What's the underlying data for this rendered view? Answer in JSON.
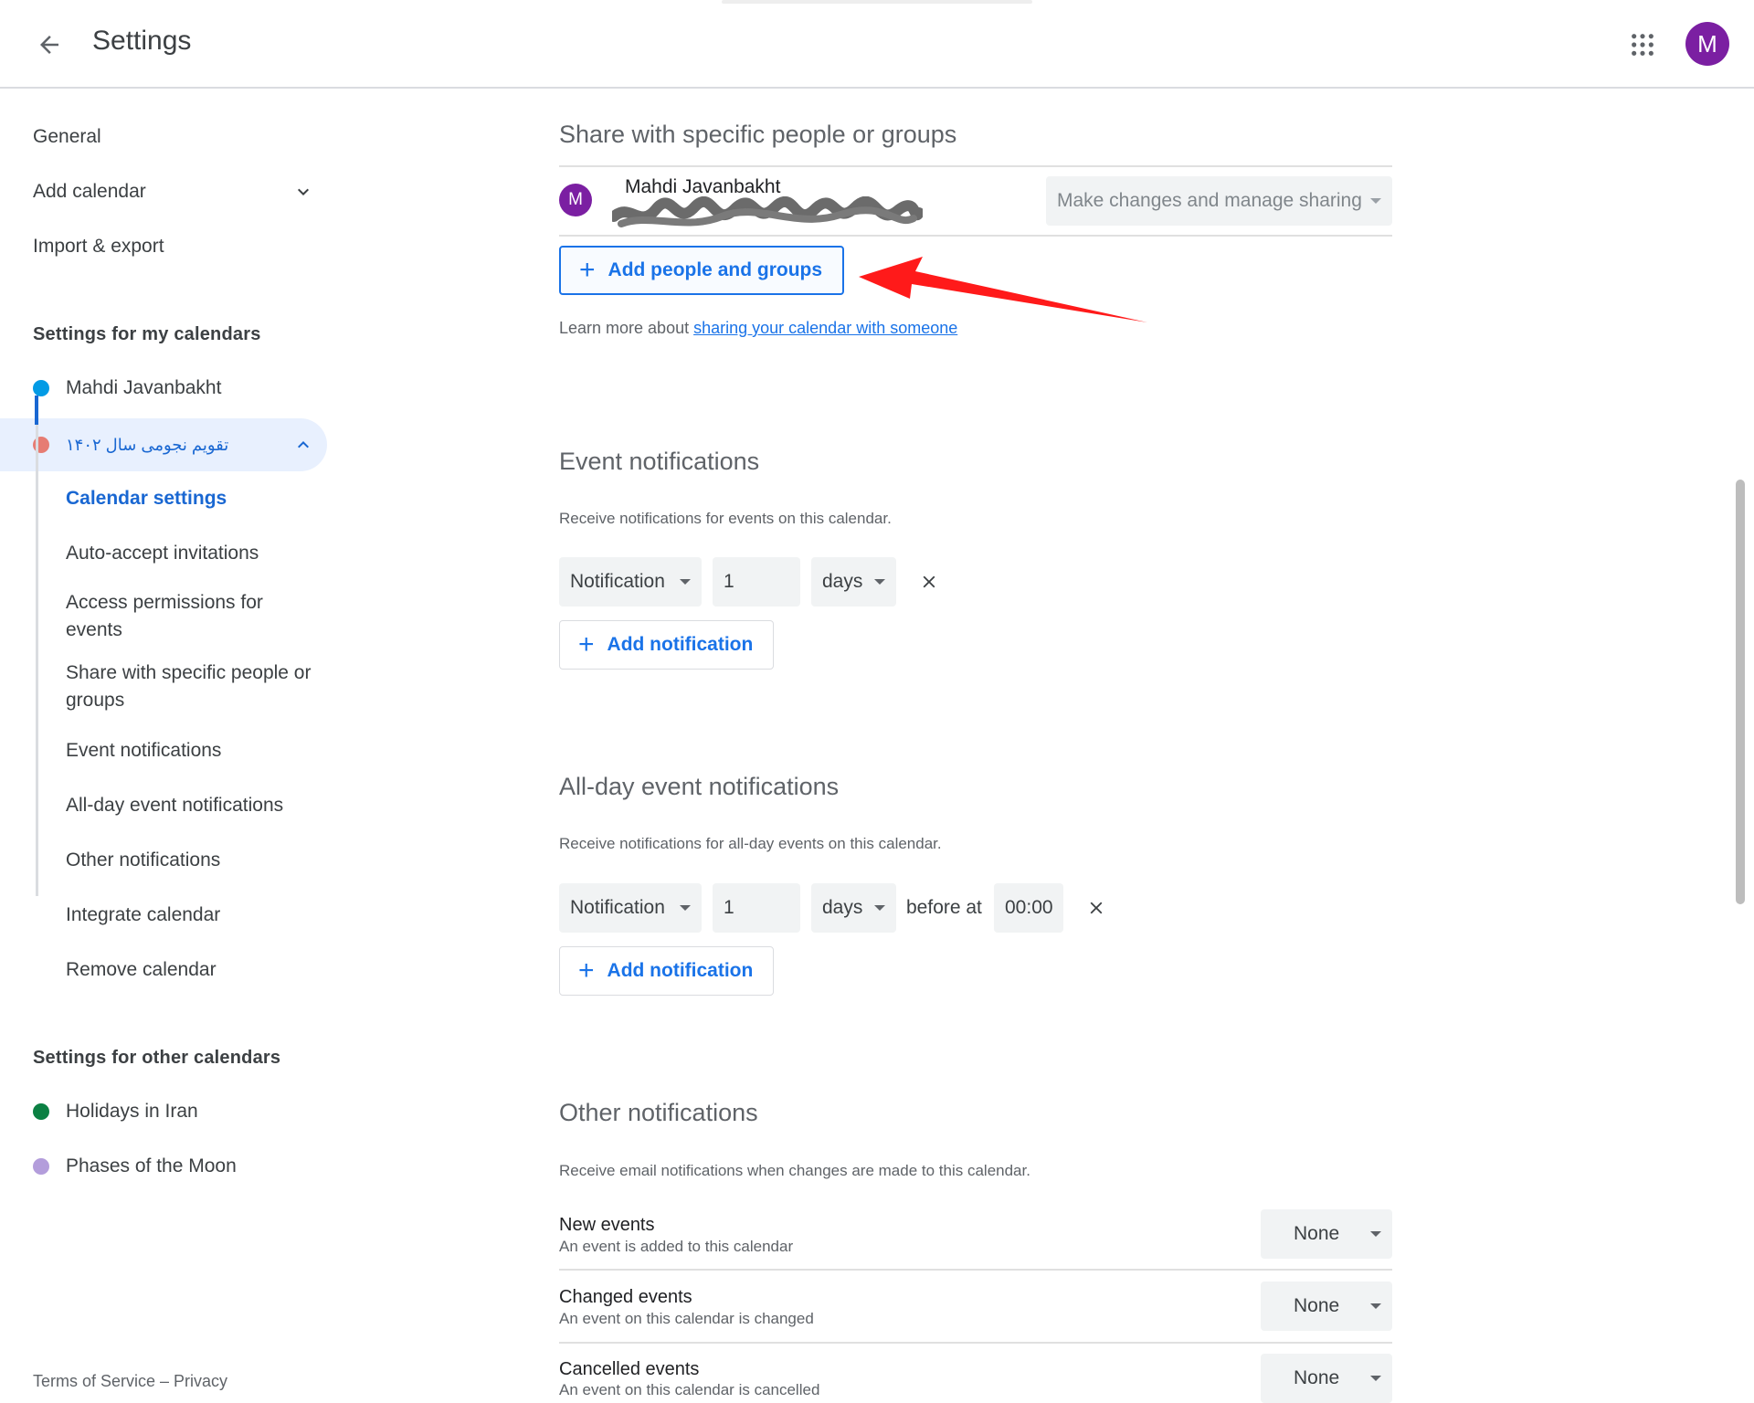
{
  "header": {
    "title": "Settings",
    "avatar_letter": "M"
  },
  "sidebar": {
    "general": "General",
    "add_calendar": "Add calendar",
    "import_export": "Import & export",
    "my_calendars_heading": "Settings for my calendars",
    "my_calendars": [
      {
        "label": "Mahdi Javanbakht",
        "color": "#039be5"
      },
      {
        "label": "تقویم نجومی سال ۱۴۰۲",
        "color": "#e67c73"
      }
    ],
    "sub_items": [
      "Calendar settings",
      "Auto-accept invitations",
      "Access permissions for events",
      "Share with specific people or groups",
      "Event notifications",
      "All-day event notifications",
      "Other notifications",
      "Integrate calendar",
      "Remove calendar"
    ],
    "other_calendars_heading": "Settings for other calendars",
    "other_calendars": [
      {
        "label": "Holidays in Iran",
        "color": "#0b8043"
      },
      {
        "label": "Phases of the Moon",
        "color": "#b39ddb"
      }
    ],
    "footer": "Terms of Service – Privacy"
  },
  "share": {
    "heading": "Share with specific people or groups",
    "person_initial": "M",
    "person_name": "Mahdi Javanbakht",
    "permission": "Make changes and manage sharing",
    "add_button": "Add people and groups",
    "learn_prefix": "Learn more about ",
    "learn_link": "sharing your calendar with someone"
  },
  "event_notifications": {
    "heading": "Event notifications",
    "desc": "Receive notifications for events on this calendar.",
    "type": "Notification",
    "amount": "1",
    "unit": "days",
    "add_button": "Add notification"
  },
  "allday_notifications": {
    "heading": "All-day event notifications",
    "desc": "Receive notifications for all-day events on this calendar.",
    "type": "Notification",
    "amount": "1",
    "unit": "days",
    "before_at": "before at",
    "time": "00:00",
    "add_button": "Add notification"
  },
  "other_notifications": {
    "heading": "Other notifications",
    "desc": "Receive email notifications when changes are made to this calendar.",
    "rows": [
      {
        "title": "New events",
        "sub": "An event is added to this calendar",
        "value": "None"
      },
      {
        "title": "Changed events",
        "sub": "An event on this calendar is changed",
        "value": "None"
      },
      {
        "title": "Cancelled events",
        "sub": "An event on this calendar is cancelled",
        "value": "None"
      }
    ]
  },
  "colors": {
    "accent": "#1a73e8",
    "avatar": "#7b1fa2",
    "annotation_arrow": "#ff0000"
  }
}
